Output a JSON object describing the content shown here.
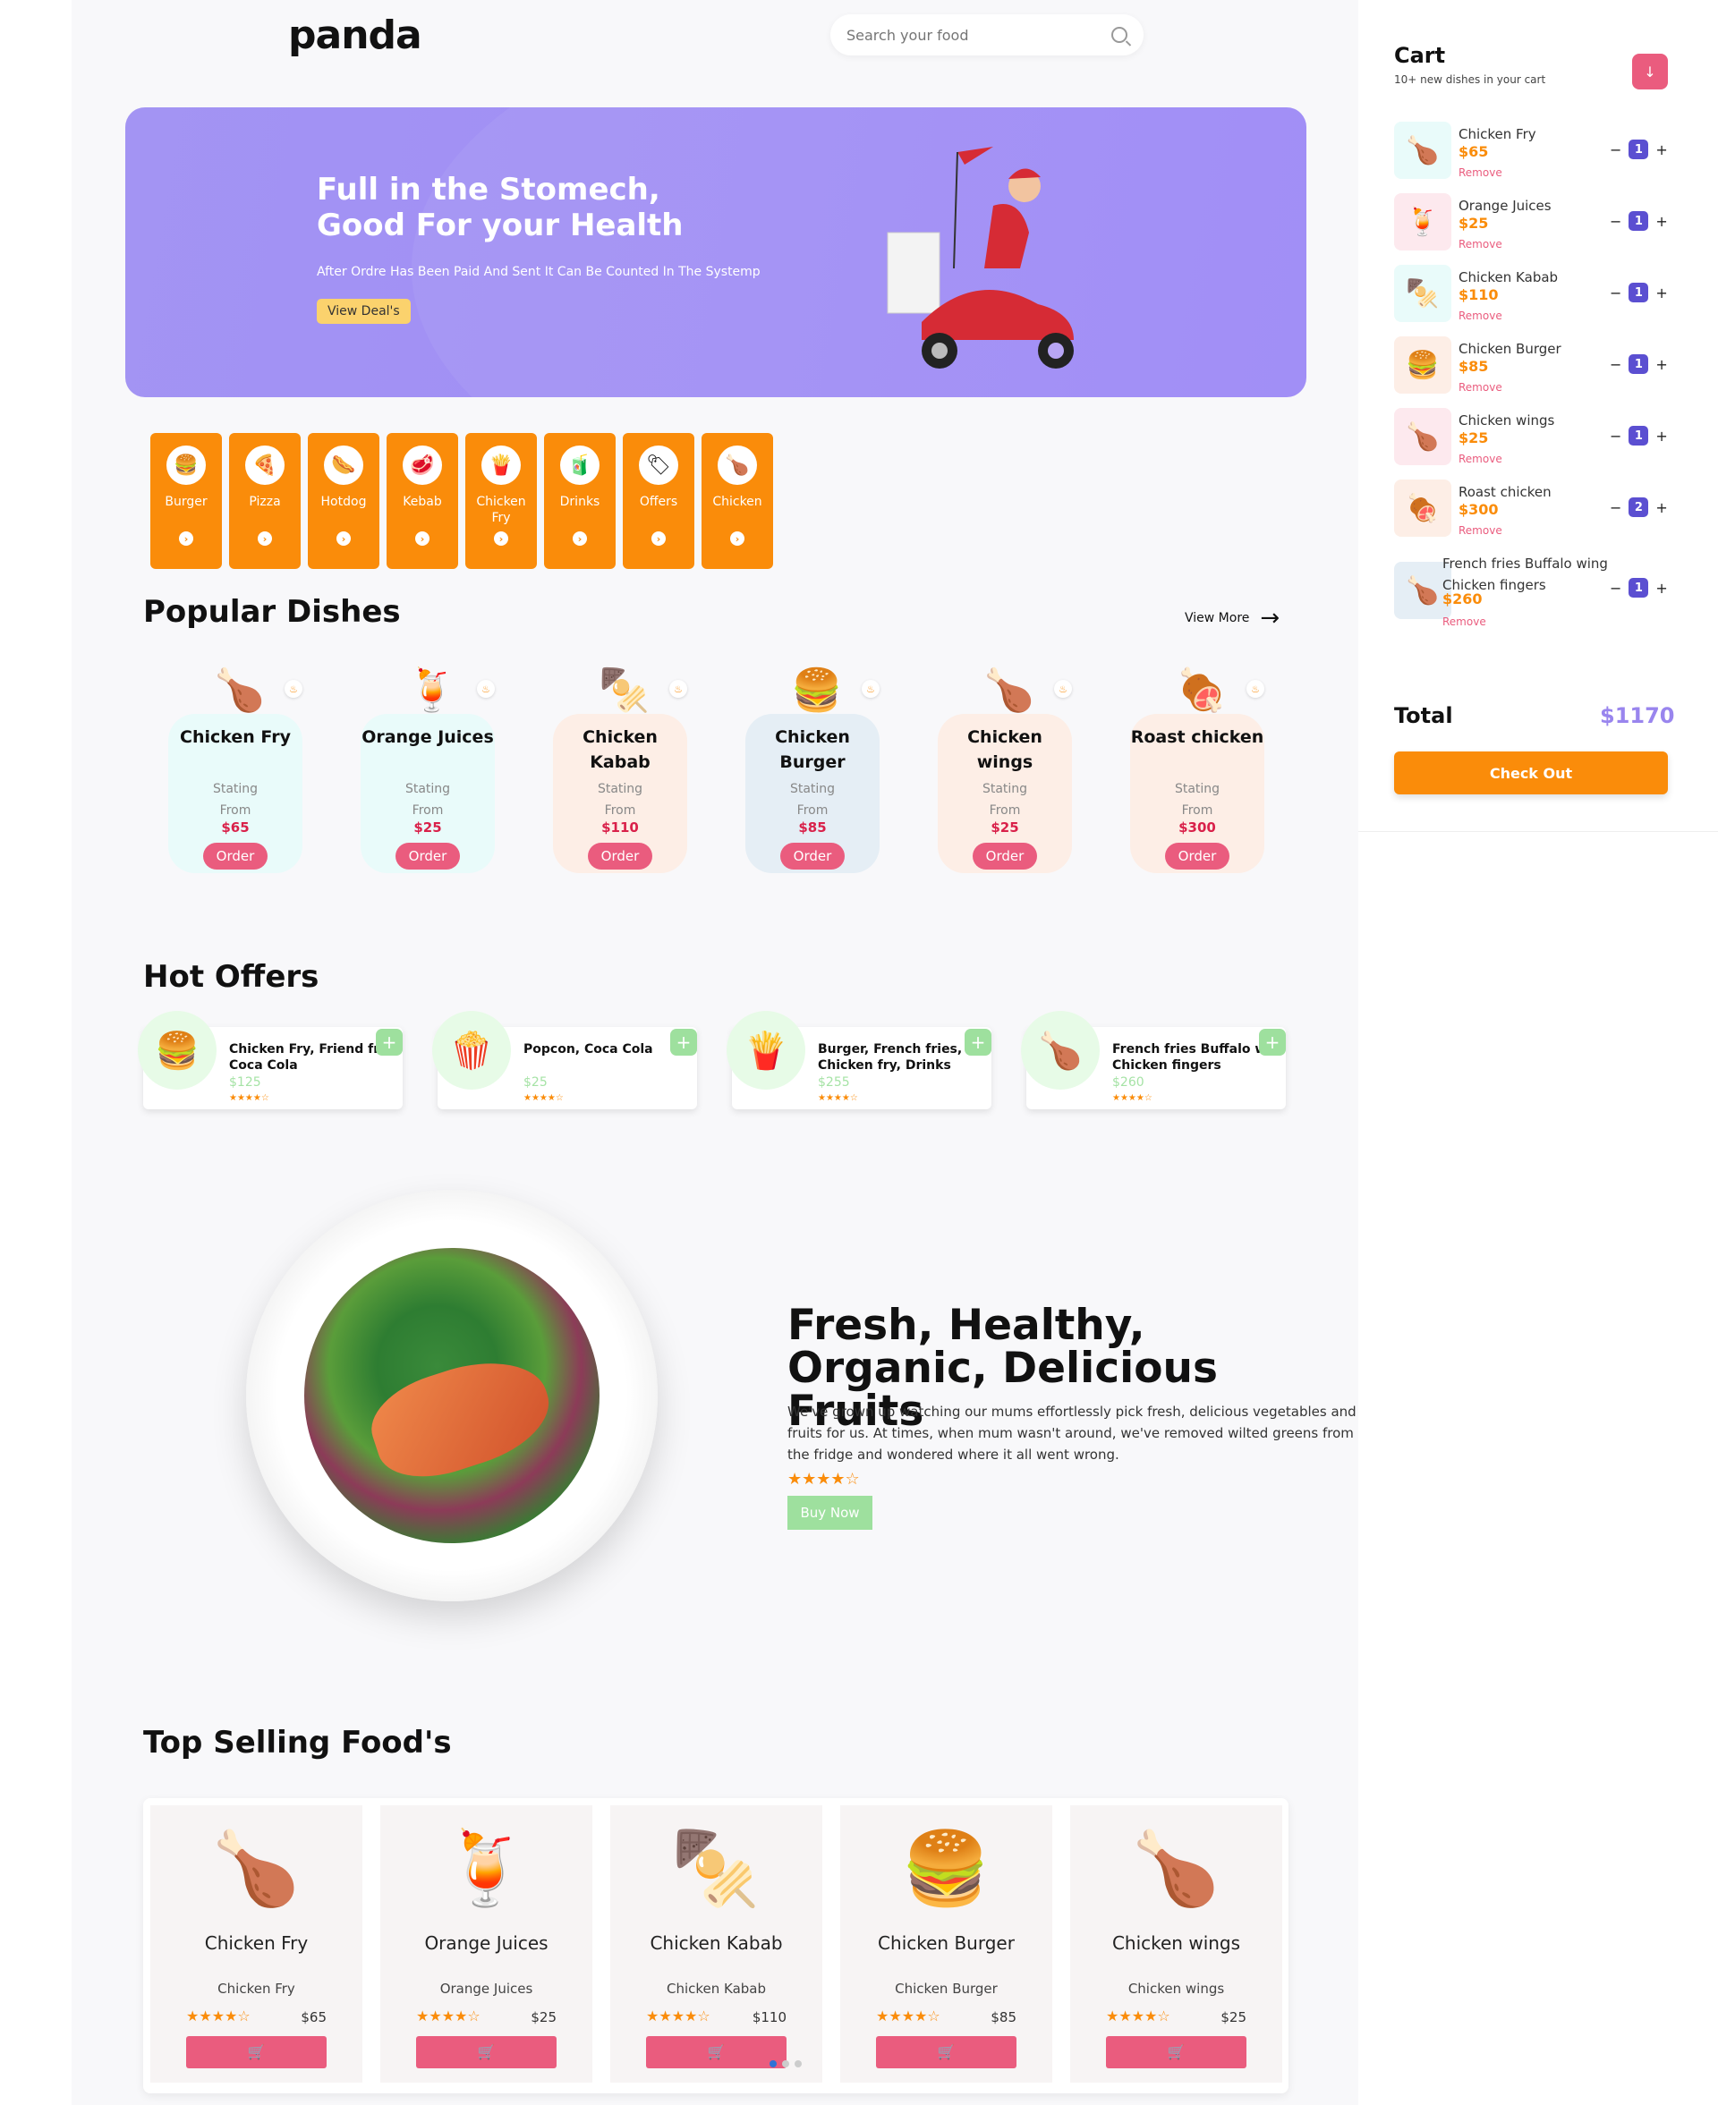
{
  "header": {
    "logo": "panda",
    "search_placeholder": "Search your food"
  },
  "hero": {
    "title": "Full in the Stomech, Good For your Health",
    "subtitle": "After Ordre Has Been Paid And Sent It Can Be Counted In The Systemp",
    "button": "View Deal's"
  },
  "categories": [
    {
      "label": "Burger",
      "icon": "🍔"
    },
    {
      "label": "Pizza",
      "icon": "🍕"
    },
    {
      "label": "Hotdog",
      "icon": "🌭"
    },
    {
      "label": "Kebab",
      "icon": "🥩"
    },
    {
      "label": "Chicken Fry",
      "icon": "🍟"
    },
    {
      "label": "Drinks",
      "icon": "🧃"
    },
    {
      "label": "Offers",
      "icon": "🏷"
    },
    {
      "label": "Chicken",
      "icon": "🍗"
    }
  ],
  "popular": {
    "title": "Popular Dishes",
    "view_more": "View More",
    "dishes": [
      {
        "name": "Chicken Fry",
        "st1": "Stating",
        "st2": "From",
        "price": "$65",
        "order": "Order",
        "icon": "🍗",
        "color": "#e9fbfa"
      },
      {
        "name": "Orange Juices",
        "st1": "Stating",
        "st2": "From",
        "price": "$25",
        "order": "Order",
        "icon": "🍹",
        "color": "#e9fbfa"
      },
      {
        "name": "Chicken Kabab",
        "st1": "Stating",
        "st2": "From",
        "price": "$110",
        "order": "Order",
        "icon": "🍢",
        "color": "#fdeee6"
      },
      {
        "name": "Chicken Burger",
        "st1": "Stating",
        "st2": "From",
        "price": "$85",
        "order": "Order",
        "icon": "🍔",
        "color": "#e5eef5"
      },
      {
        "name": "Chicken wings",
        "st1": "Stating",
        "st2": "From",
        "price": "$25",
        "order": "Order",
        "icon": "🍗",
        "color": "#fdeee6"
      },
      {
        "name": "Roast chicken",
        "st1": "Stating",
        "st2": "From",
        "price": "$300",
        "order": "Order",
        "icon": "🍖",
        "color": "#fdeee6"
      }
    ]
  },
  "offers": {
    "title": "Hot Offers",
    "items": [
      {
        "line1": "Chicken Fry, Friend fr",
        "line2": "Coca Cola",
        "price": "$125",
        "stars": "★★★★☆",
        "icon": "🍔"
      },
      {
        "line1": "Popcon, Coca Cola",
        "line2": "",
        "price": "$25",
        "stars": "★★★★☆",
        "icon": "🍿"
      },
      {
        "line1": "Burger, French fries,",
        "line2": "Chicken fry, Drinks",
        "price": "$255",
        "stars": "★★★★☆",
        "icon": "🍟"
      },
      {
        "line1": "French fries Buffalo w",
        "line2": "Chicken fingers",
        "price": "$260",
        "stars": "★★★★☆",
        "icon": "🍗"
      }
    ]
  },
  "fresh": {
    "title": "Fresh, Healthy, Organic, Delicious Fruits",
    "text": "We've grown up watching our mums effortlessly pick fresh, delicious vegetables and fruits for us. At times, when mum wasn't around, we've removed wilted greens from the fridge and wondered where it all went wrong.",
    "stars": "★★★★☆",
    "button": "Buy Now"
  },
  "top": {
    "title": "Top Selling Food's",
    "items": [
      {
        "name": "Chicken Fry",
        "sub": "Chicken Fry",
        "price": "$65",
        "stars": "★★★★☆",
        "icon": "🍗"
      },
      {
        "name": "Orange Juices",
        "sub": "Orange Juices",
        "price": "$25",
        "stars": "★★★★☆",
        "icon": "🍹"
      },
      {
        "name": "Chicken Kabab",
        "sub": "Chicken Kabab",
        "price": "$110",
        "stars": "★★★★☆",
        "icon": "🍢"
      },
      {
        "name": "Chicken Burger",
        "sub": "Chicken Burger",
        "price": "$85",
        "stars": "★★★★☆",
        "icon": "🍔"
      },
      {
        "name": "Chicken wings",
        "sub": "Chicken wings",
        "price": "$25",
        "stars": "★★★★☆",
        "icon": "🍗"
      }
    ]
  },
  "cart": {
    "title": "Cart",
    "subtitle": "10+ new dishes in your cart",
    "items": [
      {
        "name": "Chicken Fry",
        "price": "$65",
        "remove": "Remove",
        "qty": "1",
        "icon": "🍗",
        "color": "#e9fbfa"
      },
      {
        "name": "Orange Juices",
        "price": "$25",
        "remove": "Remove",
        "qty": "1",
        "icon": "🍹",
        "color": "#fde9ee"
      },
      {
        "name": "Chicken Kabab",
        "price": "$110",
        "remove": "Remove",
        "qty": "1",
        "icon": "🍢",
        "color": "#e9fbfa"
      },
      {
        "name": "Chicken Burger",
        "price": "$85",
        "remove": "Remove",
        "qty": "1",
        "icon": "🍔",
        "color": "#fdeee6"
      },
      {
        "name": "Chicken wings",
        "price": "$25",
        "remove": "Remove",
        "qty": "1",
        "icon": "🍗",
        "color": "#fde9ee"
      },
      {
        "name": "Roast chicken",
        "price": "$300",
        "remove": "Remove",
        "qty": "2",
        "icon": "🍖",
        "color": "#fdeee6"
      },
      {
        "name": "French fries Buffalo wing Chicken fingers",
        "price": "$260",
        "remove": "Remove",
        "qty": "1",
        "icon": "🍗",
        "color": "#e5eef5"
      }
    ],
    "total_label": "Total",
    "total_value": "$1170",
    "checkout": "Check Out"
  }
}
